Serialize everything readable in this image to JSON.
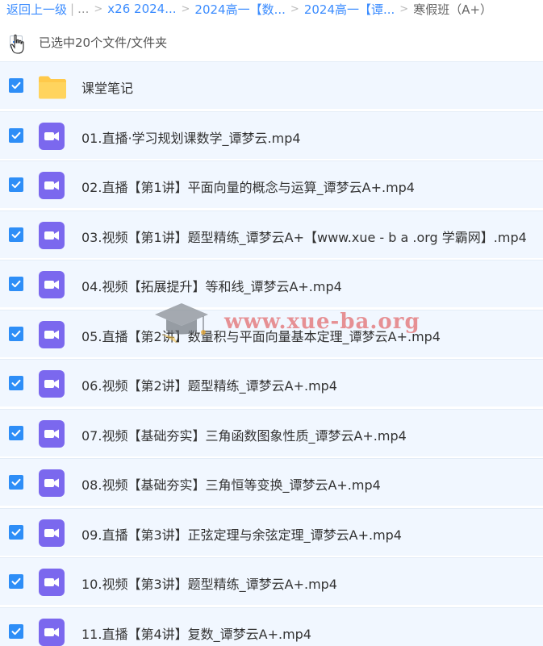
{
  "breadcrumb": {
    "back_label": "返回上一级",
    "divider": "|",
    "ellipsis": "...",
    "crumbs": [
      "x26 2024...",
      "2024高一【数...",
      "2024高一【谭..."
    ],
    "current": "寒假班（A+）"
  },
  "selection": {
    "summary": "已选中20个文件/文件夹"
  },
  "files": [
    {
      "name": "课堂笔记",
      "type": "folder"
    },
    {
      "name": "01.直播·学习规划课数学_谭梦云.mp4",
      "type": "video"
    },
    {
      "name": "02.直播【第1讲】平面向量的概念与运算_谭梦云A+.mp4",
      "type": "video"
    },
    {
      "name": "03.视频【第1讲】题型精练_谭梦云A+【www.xue - b a .org 学霸网】.mp4",
      "type": "video"
    },
    {
      "name": "04.视频【拓展提升】等和线_谭梦云A+.mp4",
      "type": "video"
    },
    {
      "name": "05.直播【第2讲】数量积与平面向量基本定理_谭梦云A+.mp4",
      "type": "video"
    },
    {
      "name": "06.视频【第2讲】题型精练_谭梦云A+.mp4",
      "type": "video"
    },
    {
      "name": "07.视频【基础夯实】三角函数图象性质_谭梦云A+.mp4",
      "type": "video"
    },
    {
      "name": "08.视频【基础夯实】三角恒等变换_谭梦云A+.mp4",
      "type": "video"
    },
    {
      "name": "09.直播【第3讲】正弦定理与余弦定理_谭梦云A+.mp4",
      "type": "video"
    },
    {
      "name": "10.视频【第3讲】题型精练_谭梦云A+.mp4",
      "type": "video"
    },
    {
      "name": "11.直播【第4讲】复数_谭梦云A+.mp4",
      "type": "video"
    }
  ],
  "watermark": {
    "text": "www.xue-ba.org"
  },
  "colors": {
    "link": "#3b8cff",
    "checkbox": "#2e8ef7",
    "row_bg": "#f1f7ff",
    "video_icon": "#7b68ee",
    "folder_icon": "#ffc94a"
  }
}
